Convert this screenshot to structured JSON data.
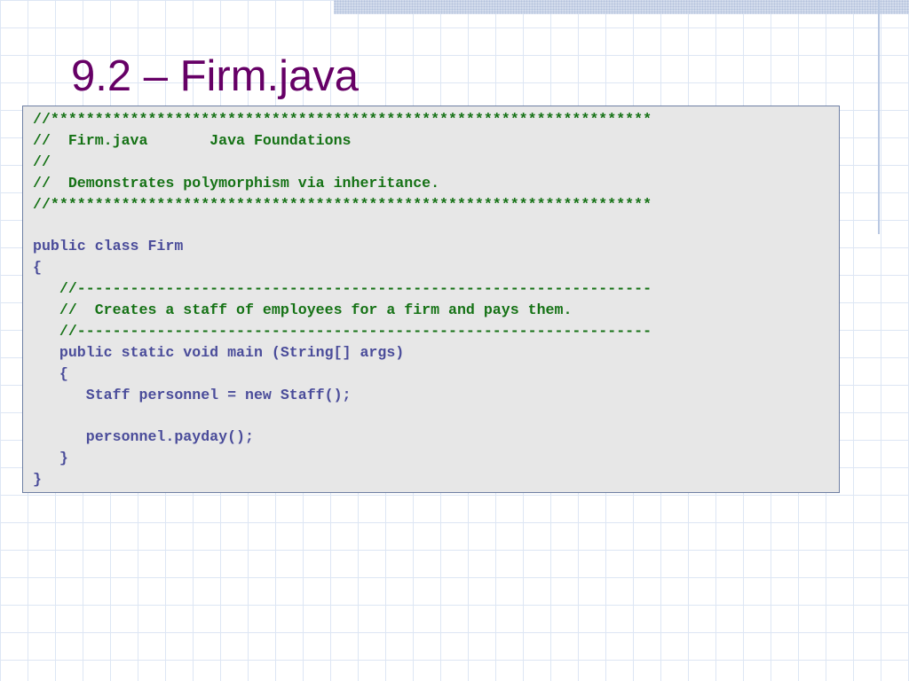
{
  "slide": {
    "title": "9.2 – Firm.java"
  },
  "code": {
    "lines": [
      {
        "text": "//********************************************************************",
        "kind": "comment"
      },
      {
        "text": "//  Firm.java       Java Foundations",
        "kind": "comment"
      },
      {
        "text": "//",
        "kind": "comment"
      },
      {
        "text": "//  Demonstrates polymorphism via inheritance.",
        "kind": "comment"
      },
      {
        "text": "//********************************************************************",
        "kind": "comment"
      },
      {
        "text": "",
        "kind": "code"
      },
      {
        "text": "public class Firm",
        "kind": "code"
      },
      {
        "text": "{",
        "kind": "code"
      },
      {
        "text": "   //-----------------------------------------------------------------",
        "kind": "comment"
      },
      {
        "text": "   //  Creates a staff of employees for a firm and pays them.",
        "kind": "comment"
      },
      {
        "text": "   //-----------------------------------------------------------------",
        "kind": "comment"
      },
      {
        "text": "   public static void main (String[] args)",
        "kind": "code"
      },
      {
        "text": "   {",
        "kind": "code"
      },
      {
        "text": "      Staff personnel = new Staff();",
        "kind": "code"
      },
      {
        "text": "",
        "kind": "code"
      },
      {
        "text": "      personnel.payday();",
        "kind": "code"
      },
      {
        "text": "   }",
        "kind": "code"
      },
      {
        "text": "}",
        "kind": "code"
      }
    ]
  },
  "colors": {
    "title": "#660066",
    "comment": "#157215",
    "code": "#4a4c9a",
    "code_background": "#e7e7e7"
  }
}
